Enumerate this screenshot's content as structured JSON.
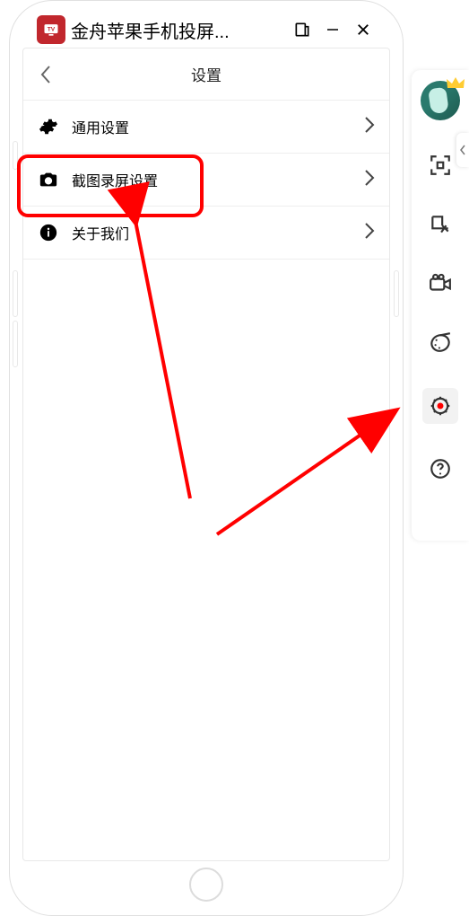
{
  "titlebar": {
    "app_name": "金舟苹果手机投屏..."
  },
  "page": {
    "header_title": "设置"
  },
  "rows": [
    {
      "label": "通用设置"
    },
    {
      "label": "截图录屏设置"
    },
    {
      "label": "关于我们"
    }
  ],
  "sidebar": {
    "items": [
      {
        "name": "avatar"
      },
      {
        "name": "fullscreen"
      },
      {
        "name": "crop"
      },
      {
        "name": "record"
      },
      {
        "name": "palette"
      },
      {
        "name": "settings",
        "active": true
      },
      {
        "name": "help"
      }
    ]
  },
  "annotations": {
    "highlight_row_index": 1,
    "arrows": [
      {
        "from": "row-screenshot",
        "to": "below"
      },
      {
        "from": "content-area",
        "to": "sidebar-settings"
      }
    ]
  }
}
